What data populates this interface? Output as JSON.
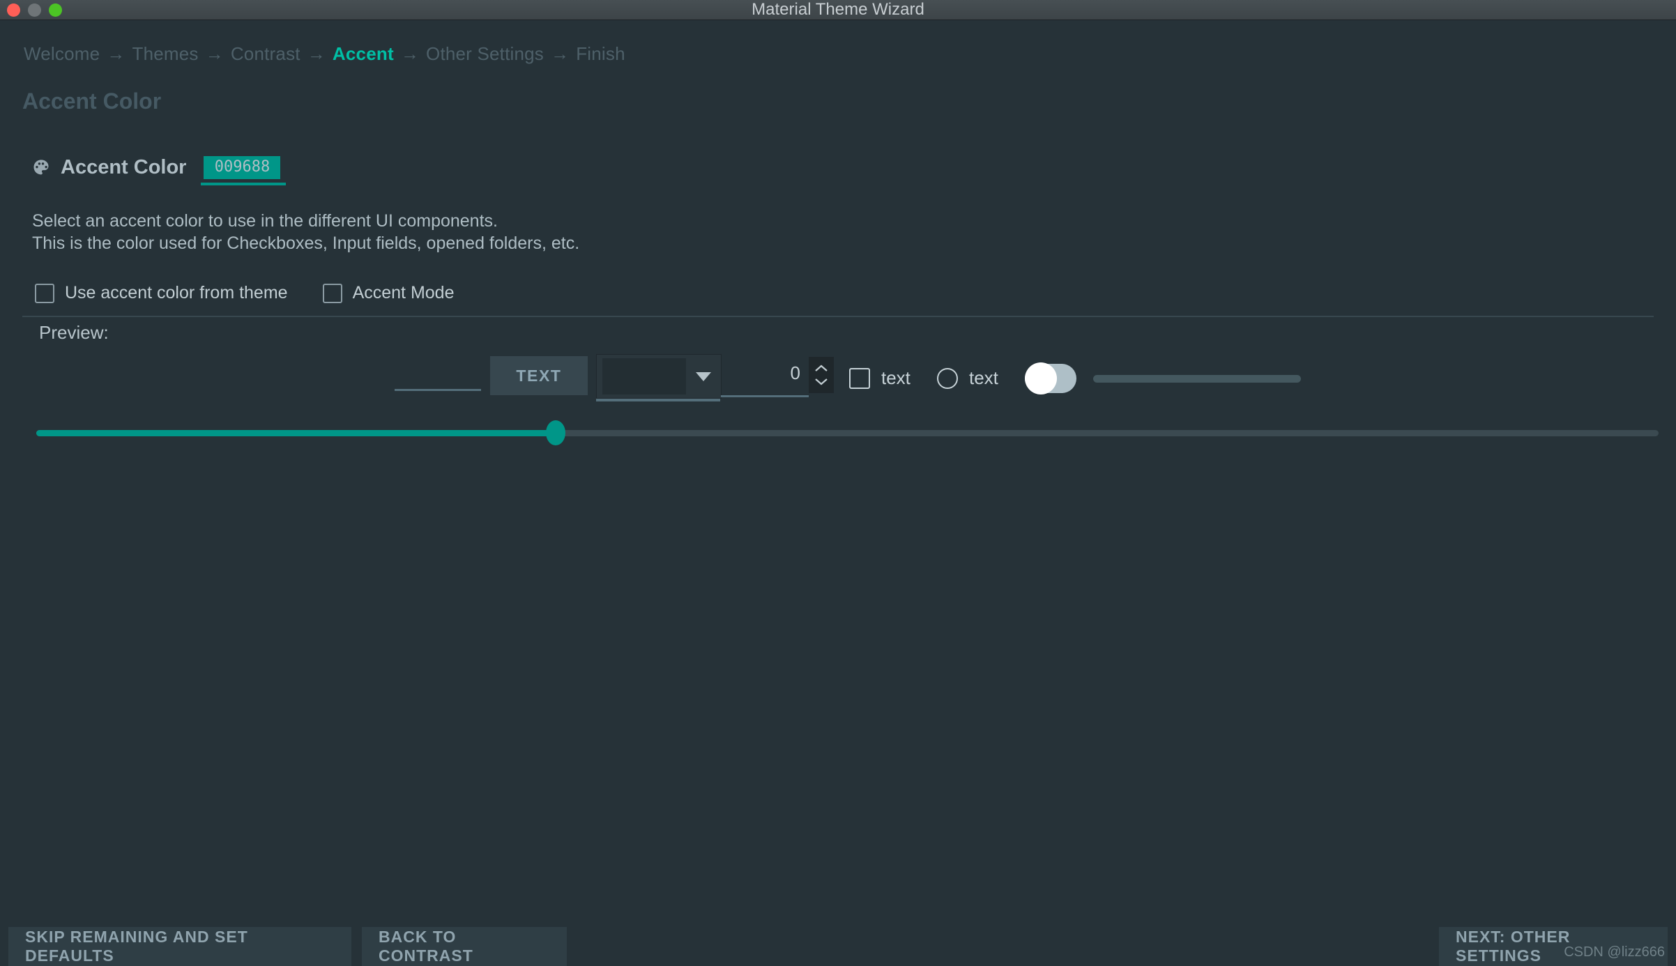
{
  "window": {
    "title": "Material Theme Wizard",
    "controls": [
      "close",
      "minimize",
      "zoom"
    ]
  },
  "breadcrumb": {
    "separator": "→",
    "items": [
      {
        "label": "Welcome",
        "active": false
      },
      {
        "label": "Themes",
        "active": false
      },
      {
        "label": "Contrast",
        "active": false
      },
      {
        "label": "Accent",
        "active": true
      },
      {
        "label": "Other Settings",
        "active": false
      },
      {
        "label": "Finish",
        "active": false
      }
    ]
  },
  "page": {
    "title": "Accent Color",
    "section": {
      "icon": "palette-icon",
      "label": "Accent Color",
      "hex_value": "009688"
    },
    "description_line1": "Select an accent color to use in the different UI components.",
    "description_line2": "This is the color used for Checkboxes, Input fields, opened folders, etc.",
    "options": [
      {
        "label": "Use accent color from theme",
        "checked": false
      },
      {
        "label": "Accent Mode",
        "checked": false
      }
    ]
  },
  "preview": {
    "label": "Preview:",
    "text_field_value": "",
    "button_label": "TEXT",
    "combo_value": "",
    "spinner_value": "0",
    "checkbox_label": "text",
    "checkbox_checked": false,
    "radio_label": "text",
    "radio_checked": false,
    "toggle_on": false,
    "progress_percent": 0,
    "slider_percent": 32
  },
  "footer": {
    "skip_label": "SKIP REMAINING AND SET DEFAULTS",
    "back_label": "BACK TO CONTRAST",
    "next_label": "NEXT: OTHER SETTINGS"
  },
  "watermark": "CSDN @lizz666",
  "colors": {
    "accent": "#009688",
    "breadcrumb_active": "#00bfa5",
    "background": "#263238",
    "titlebar": "#3d4448"
  }
}
